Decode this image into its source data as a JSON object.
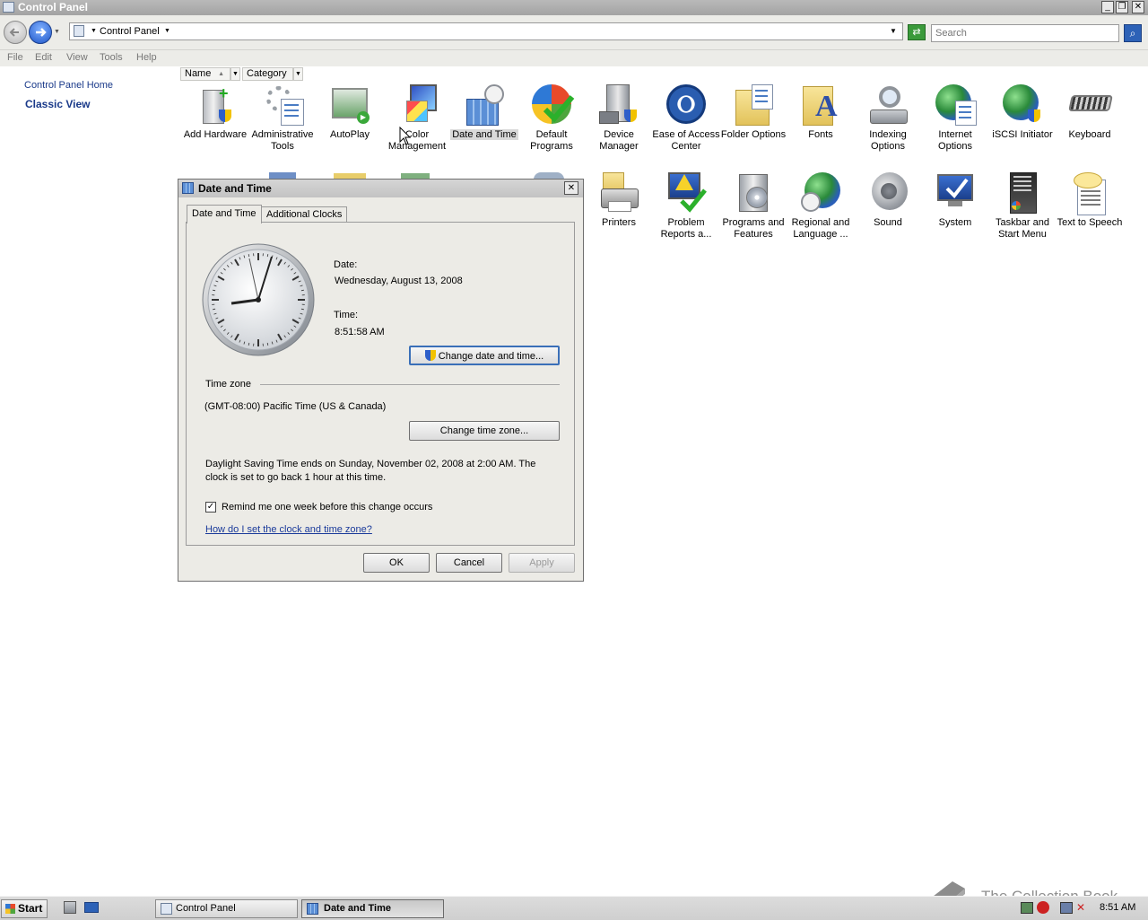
{
  "window": {
    "title": "Control Panel"
  },
  "address": {
    "path": "Control Panel",
    "search_placeholder": "Search"
  },
  "menu": [
    "File",
    "Edit",
    "View",
    "Tools",
    "Help"
  ],
  "leftpane": {
    "home": "Control Panel Home",
    "classic": "Classic View"
  },
  "columns": {
    "name": "Name",
    "category": "Category"
  },
  "items_row1": [
    "Add Hardware",
    "Administrative Tools",
    "AutoPlay",
    "Color Management",
    "Date and Time",
    "Default Programs",
    "Device Manager",
    "Ease of Access Center",
    "Folder Options",
    "Fonts",
    "Indexing Options",
    "Internet Options",
    "iSCSI Initiator",
    "Keyboard"
  ],
  "items_row2": [
    "Printers",
    "Problem Reports a...",
    "Programs and Features",
    "Regional and Language ...",
    "Sound",
    "System",
    "Taskbar and Start Menu",
    "Text to Speech"
  ],
  "dialog": {
    "title": "Date and Time",
    "tabs": [
      "Date and Time",
      "Additional Clocks"
    ],
    "date_label": "Date:",
    "date_value": "Wednesday, August 13, 2008",
    "time_label": "Time:",
    "time_value": "8:51:58 AM",
    "change_datetime": "Change date and time...",
    "timezone_heading": "Time zone",
    "timezone_value": "(GMT-08:00) Pacific Time (US & Canada)",
    "change_timezone": "Change time zone...",
    "dst_line1": "Daylight Saving Time ends on Sunday, November 02, 2008 at 2:00 AM. The",
    "dst_line2": "clock is set to go back 1 hour at this time.",
    "remind": "Remind me one week before this change occurs",
    "remind_checked": true,
    "help_link": "How do I set the clock and time zone?",
    "ok": "OK",
    "cancel": "Cancel",
    "apply": "Apply"
  },
  "taskbar": {
    "start": "Start",
    "tasks": [
      "Control Panel",
      "Date and Time"
    ],
    "clock": "8:51 AM"
  },
  "watermark": "The Collection Book"
}
